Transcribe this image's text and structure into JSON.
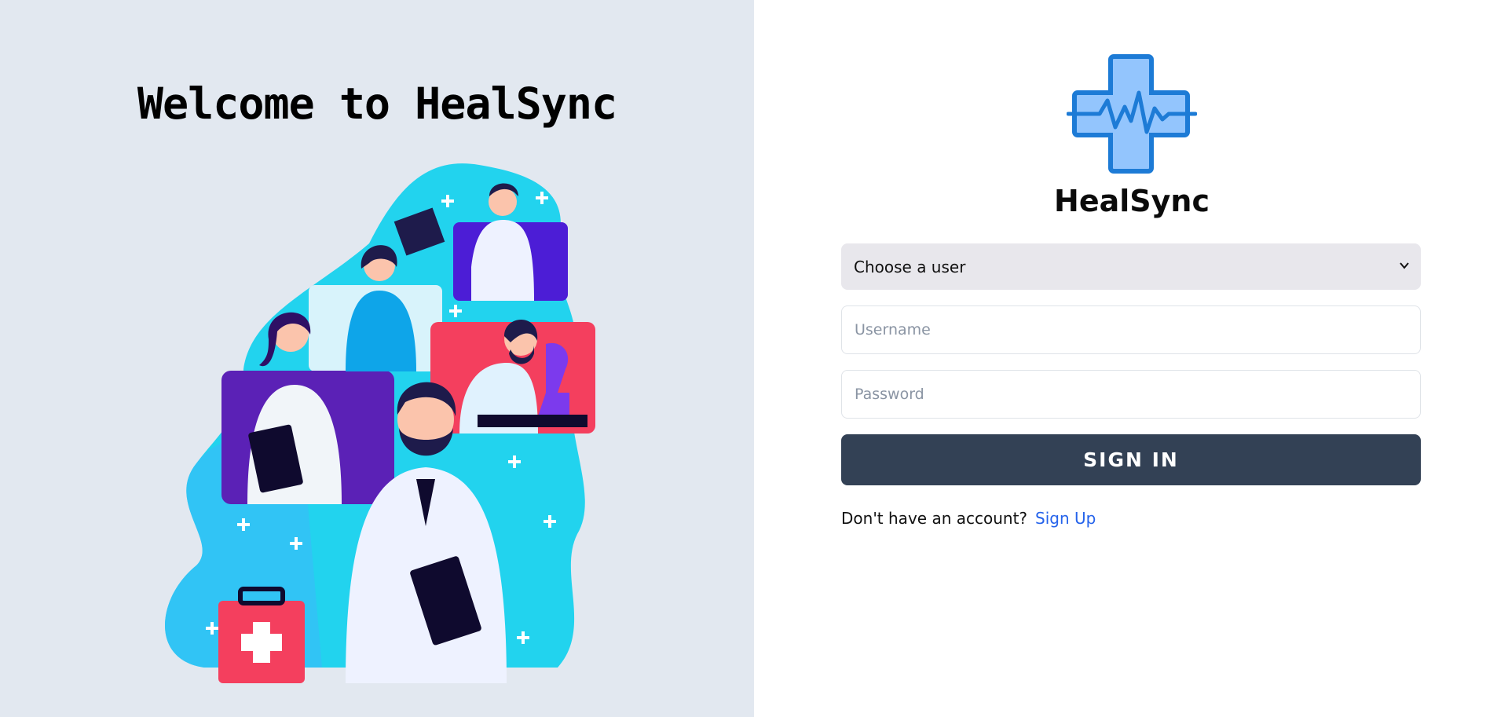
{
  "welcome": {
    "heading": "Welcome to HealSync"
  },
  "brand": {
    "name": "HealSync",
    "logo_icon": "medical-cross-heartbeat-icon"
  },
  "login": {
    "user_select": {
      "selected": "Choose a user"
    },
    "username": {
      "placeholder": "Username",
      "value": ""
    },
    "password": {
      "placeholder": "Password",
      "value": ""
    },
    "submit_label": "SIGN IN",
    "signup_prompt": "Don't have an account?",
    "signup_link": "Sign Up"
  },
  "colors": {
    "left_bg": "#e2e8f0",
    "button_bg": "#334155",
    "link": "#2563eb",
    "logo_fill": "#93c5fd",
    "logo_stroke": "#1d7bd6"
  }
}
